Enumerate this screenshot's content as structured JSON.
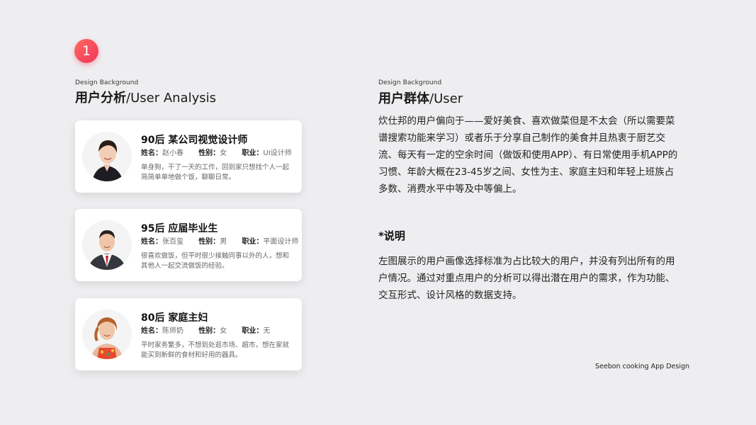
{
  "badge": "1",
  "left": {
    "eyebrow": "Design Background",
    "heading_cn": "用户分析",
    "heading_en": "/User Analysis"
  },
  "right": {
    "eyebrow": "Design Background",
    "heading_cn": "用户群体",
    "heading_en": "/User",
    "paragraph": "炊仕邦的用户偏向于——爱好美食、喜欢做菜但是不太会（所以需要菜谱搜索功能来学习）或者乐于分享自己制作的美食并且热衷于厨艺交流、每天有一定的空余时间（做饭和使用APP）、有日常使用手机APP的习惯、年龄大概在23-45岁之间、女性为主、家庭主妇和年轻上班族占多数、消费水平中等及中等偏上。",
    "note_heading": "*说明",
    "note_paragraph": "左图展示的用户画像选择标准为占比较大的用户，并没有列出所有的用户情况。通过对重点用户的分析可以得出潜在用户的需求，作为功能、交互形式、设计风格的数据支持。"
  },
  "labels": {
    "name": "姓名：",
    "gender": "性别：",
    "job": "职业："
  },
  "personas": [
    {
      "title": "90后  某公司视觉设计师",
      "name": "赵小春",
      "gender": "女",
      "job": "UI设计师",
      "desc": "单身狗，干了一天的工作，回到家只想找个人一起简简单单地做个饭，聊聊日常。"
    },
    {
      "title": "95后  应届毕业生",
      "name": "张百玺",
      "gender": "男",
      "job": "平面设计师",
      "desc": "很喜欢做饭，但平时很少接触同事以外的人，想和其他人一起交流做饭的经验。"
    },
    {
      "title": "80后  家庭主妇",
      "name": "陈师奶",
      "gender": "女",
      "job": "无",
      "desc": "平时家务繁多，不想到处逛市场、超市，想在家就能买到新鲜的食材和好用的器具。"
    }
  ],
  "footer": "Seebon cooking App Design"
}
